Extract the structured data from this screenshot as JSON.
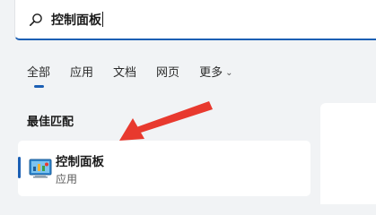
{
  "search": {
    "query": "控制面板",
    "icon": "search-icon"
  },
  "tabs": [
    {
      "label": "全部",
      "active": true
    },
    {
      "label": "应用",
      "active": false
    },
    {
      "label": "文档",
      "active": false
    },
    {
      "label": "网页",
      "active": false
    },
    {
      "label": "更多",
      "active": false
    }
  ],
  "section": {
    "title": "最佳匹配"
  },
  "best_match": {
    "title": "控制面板",
    "subtitle": "应用",
    "icon": "control-panel-icon"
  },
  "colors": {
    "accent": "#1b5fb4",
    "annotation_arrow": "#e8392e",
    "background": "#f1f3f5"
  }
}
